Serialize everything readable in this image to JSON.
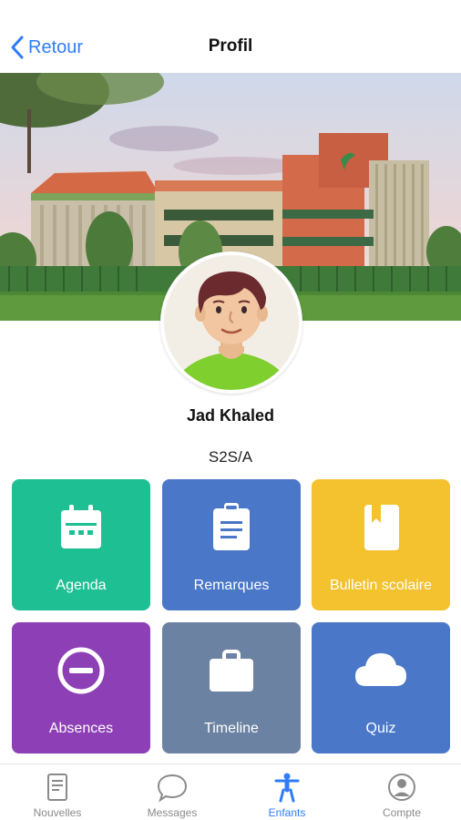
{
  "header": {
    "back_label": "Retour",
    "title": "Profil"
  },
  "profile": {
    "name": "Jad Khaled",
    "class_label": "S2S/A"
  },
  "tiles": [
    {
      "label": "Agenda",
      "icon": "calendar-icon",
      "color": "#1fbf94"
    },
    {
      "label": "Remarques",
      "icon": "clipboard-icon",
      "color": "#4a77c8"
    },
    {
      "label": "Bulletin scolaire",
      "icon": "book-icon",
      "color": "#f4c22e"
    },
    {
      "label": "Absences",
      "icon": "minus-circle-icon",
      "color": "#8d3fb5"
    },
    {
      "label": "Timeline",
      "icon": "briefcase-icon",
      "color": "#6b82a3"
    },
    {
      "label": "Quiz",
      "icon": "cloud-icon",
      "color": "#4a77c8"
    }
  ],
  "tabbar": {
    "items": [
      {
        "label": "Nouvelles",
        "icon": "document-icon",
        "active": false
      },
      {
        "label": "Messages",
        "icon": "chat-bubble-icon",
        "active": false
      },
      {
        "label": "Enfants",
        "icon": "child-icon",
        "active": true
      },
      {
        "label": "Compte",
        "icon": "account-icon",
        "active": false
      }
    ],
    "active_color": "#2f7cf6",
    "inactive_color": "#8a8a8a"
  },
  "colors": {
    "accent": "#2f7cf6"
  }
}
